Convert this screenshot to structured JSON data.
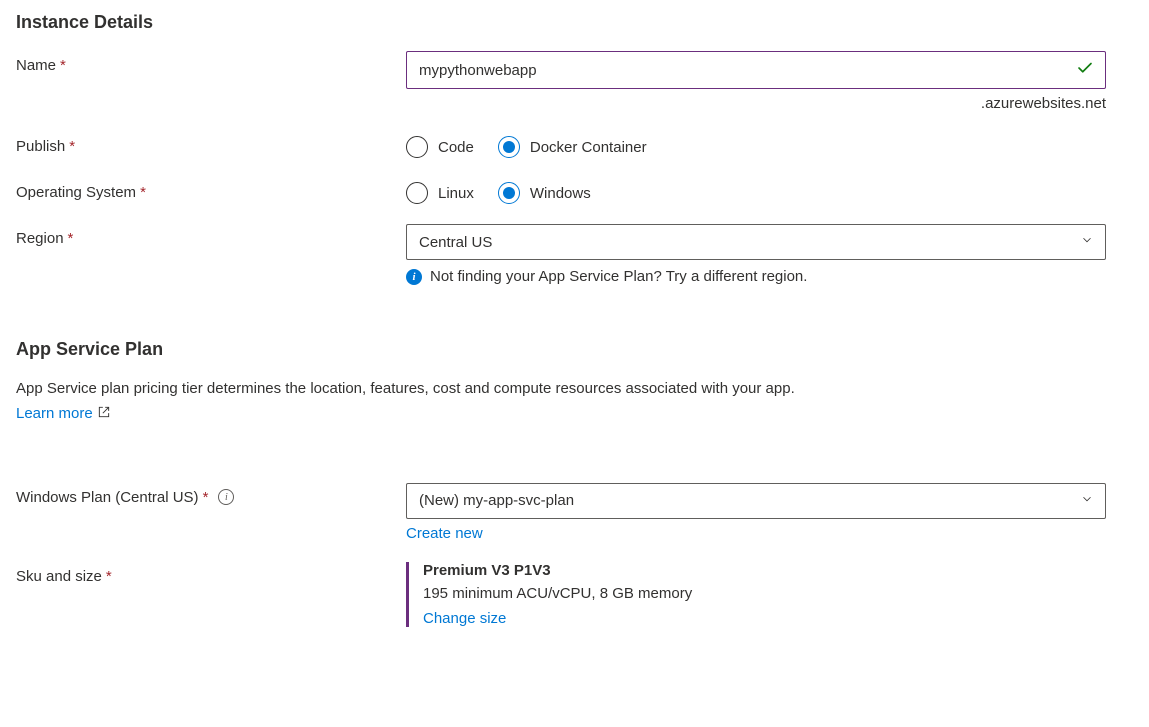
{
  "instanceDetails": {
    "header": "Instance Details",
    "name": {
      "label": "Name",
      "value": "mypythonwebapp",
      "suffix": ".azurewebsites.net"
    },
    "publish": {
      "label": "Publish",
      "options": {
        "code": "Code",
        "docker": "Docker Container"
      },
      "selected": "docker"
    },
    "os": {
      "label": "Operating System",
      "options": {
        "linux": "Linux",
        "windows": "Windows"
      },
      "selected": "windows"
    },
    "region": {
      "label": "Region",
      "value": "Central US",
      "hint": "Not finding your App Service Plan? Try a different region."
    }
  },
  "appServicePlan": {
    "header": "App Service Plan",
    "description": "App Service plan pricing tier determines the location, features, cost and compute resources associated with your app.",
    "learnMore": "Learn more",
    "plan": {
      "label": "Windows Plan (Central US)",
      "value": "(New) my-app-svc-plan",
      "createNew": "Create new"
    },
    "sku": {
      "label": "Sku and size",
      "tier": "Premium V3 P1V3",
      "detail": "195 minimum ACU/vCPU, 8 GB memory",
      "changeSize": "Change size"
    }
  }
}
